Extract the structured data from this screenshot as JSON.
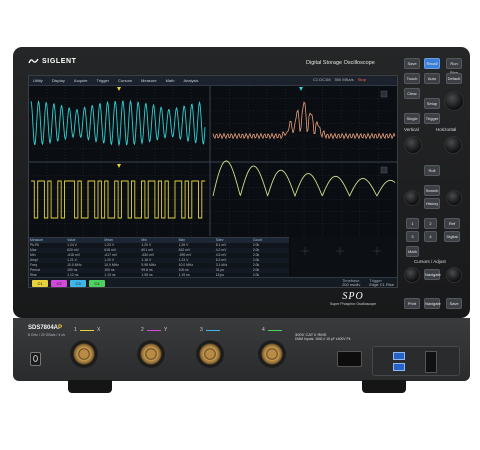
{
  "brand": {
    "logo_text": "SIGLENT"
  },
  "device": {
    "title": "Digital Storage Oscilloscope",
    "model": "SDS7804A",
    "model_suffix": "P",
    "spec_line": "8 GHz / 20 GSa/s / 4 ch",
    "sub_brand": "SPO",
    "sub_brand_caption": "Super Phosphor Oscilloscope"
  },
  "menu": {
    "items": [
      "Utility",
      "Display",
      "Acquire",
      "Trigger",
      "Cursors",
      "Measure",
      "Math",
      "Analysis"
    ]
  },
  "topright": {
    "ch1": "C1 DC1M",
    "acq": "500 MSa/s",
    "status": "Stop",
    "date": "2024-09-21"
  },
  "measure_table": {
    "headers": [
      "Measure",
      "Value",
      "Mean",
      "Min",
      "Max",
      "Sdev",
      "Count"
    ],
    "rows": [
      [
        "Pk-Pk",
        "1.24 V",
        "1.23 V",
        "1.20 V",
        "1.26 V",
        "8.1 mV",
        "2.0k"
      ],
      [
        "Max",
        "620 mV",
        "618 mV",
        "601 mV",
        "632 mV",
        "4.2 mV",
        "2.0k"
      ],
      [
        "Min",
        "-618 mV",
        "-617 mV",
        "-630 mV",
        "-599 mV",
        "4.5 mV",
        "2.0k"
      ],
      [
        "Ampl",
        "1.21 V",
        "1.20 V",
        "1.18 V",
        "1.23 V",
        "6.3 mV",
        "2.0k"
      ],
      [
        "Freq",
        "10.0 MHz",
        "10.0 MHz",
        "9.98 MHz",
        "10.0 MHz",
        "3.1 kHz",
        "2.0k"
      ],
      [
        "Period",
        "100 ns",
        "100 ns",
        "99.8 ns",
        "100 ns",
        "31 ps",
        "2.0k"
      ],
      [
        "Rise",
        "1.12 ns",
        "1.13 ns",
        "1.08 ns",
        "1.19 ns",
        "18 ps",
        "2.0k"
      ]
    ]
  },
  "status_bar": {
    "channels": [
      "C1",
      "C2",
      "C3",
      "C4"
    ],
    "timebase_label": "Timebase",
    "timebase": "200 ns/div",
    "trigger_label": "Trigger",
    "trigger": "Edge  C1  Rise"
  },
  "panel": {
    "top": [
      "Save",
      "Recall",
      "Run Stop",
      "Touch",
      "Auto",
      "Default",
      "Clear",
      "Setup",
      "Single",
      "Trigger"
    ],
    "vertical_label": "Vertical",
    "horizontal_label": "Horizontal",
    "roll": "Roll",
    "search": "Search",
    "nav": "Navigate",
    "history": "History",
    "ch_buttons": [
      "1",
      "2",
      "3",
      "4"
    ],
    "math": "Math",
    "ref": "Ref",
    "digital": "Digital",
    "cursors_label": "Cursors / Adjust",
    "bottom": [
      "Print",
      "Navigate",
      "Save"
    ]
  },
  "inputs": {
    "labels": [
      "1",
      "2",
      "3",
      "4"
    ],
    "sublabels": [
      "X",
      "Y",
      "",
      ""
    ],
    "colors": [
      "#e8d23b",
      "#d14ad9",
      "#3fb5e8",
      "#4fcf5f"
    ],
    "warning_line1": "300V CAT II RMS",
    "warning_line2": "DMM Inputs: 1MΩ // 15 pF  ±400V Pk"
  },
  "theme": {
    "ch1": "#2fd0d0",
    "ch2": "#e3d43a",
    "fft": "#e8a07a",
    "spectrum": "#c9e08c"
  }
}
